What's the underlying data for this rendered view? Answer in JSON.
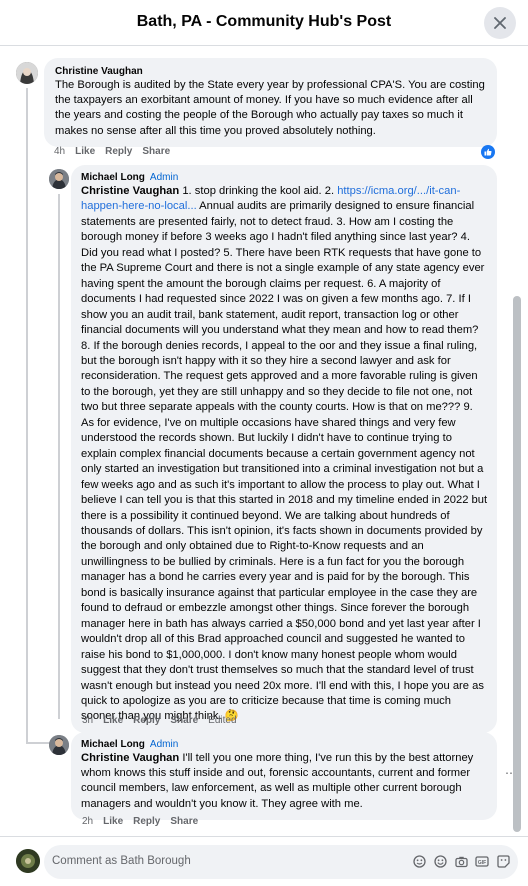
{
  "header": {
    "title": "Bath, PA - Community Hub's Post"
  },
  "comments": [
    {
      "author": "Christine Vaughan",
      "badge": "",
      "text": "The Borough is audited by the State every year by professional CPA'S. You are costing the taxpayers an exorbitant amount of money. If you have so much evidence after all the years and costing the people of the Borough who actually pay taxes so much it makes no sense after all this time you proved absolutely nothing.",
      "time": "4h",
      "like": "Like",
      "reply": "Reply",
      "share": "Share",
      "reaction": "like"
    },
    {
      "author": "Michael Long",
      "badge": "Admin",
      "mention": "Christine Vaughan",
      "text_before_link": " 1. stop drinking the kool aid. 2. ",
      "link": "https://icma.org/.../it-can-happen-here-no-local...",
      "text_after_link": " Annual audits are primarily designed to ensure financial statements are presented fairly, not to detect fraud. 3. How am I costing the borough money if before 3 weeks ago I hadn't filed anything since last year? 4. Did you read what I posted? 5. There have been RTK requests that have gone to the PA Supreme Court and there is not a single example of any state agency ever having spent the amount the borough claims per request. 6. A majority of documents I had requested since 2022 I was on given a few months ago. 7. If I show you an audit trail, bank statement, audit report, transaction log or other financial documents will you understand what they mean and how to read them? 8. If the borough denies records, I appeal to the oor and they issue a final ruling, but the borough isn't happy with it so they hire a second lawyer and ask for reconsideration. The request gets approved and a more favorable ruling is given to the borough, yet they are still unhappy and so they decide to file not one, not two but three separate appeals with the county courts. How is that on me??? 9. As for evidence, I've on multiple occasions have shared things and very few understood the records shown. But luckily I didn't have to continue trying to explain complex financial documents because a certain government agency not only started an investigation but transitioned into a criminal investigation not but a few weeks ago and as such it's important to allow the process to play out. What I believe I can tell you is that this started in 2018 and my timeline ended in 2022 but there is a possibility it continued beyond. We are talking about hundreds of thousands of dollars. This isn't opinion, it's facts shown in documents provided by the borough and only obtained due to Right-to-Know requests and an unwillingness to be bullied by criminals. Here is a fun fact for you the borough manager has a bond he carries every year and is paid for by the borough. This bond is basically insurance against that particular employee in the case they are found to defraud or embezzle amongst other things. Since forever the borough manager here in bath has always carried a $50,000 bond and yet last year after I wouldn't drop all of this Brad approached council and suggested he wanted to raise his bond to $1,000,000. I don't know many honest people whom would suggest that they don't trust themselves so much that the standard level of trust wasn't enough but instead you need 20x more. I'll end with this, I hope you are as quick to apologize as you are to criticize because that time is coming much sooner than you might think. 🤔",
      "time": "3h",
      "like": "Like",
      "reply": "Reply",
      "share": "Share",
      "edited": "Edited"
    },
    {
      "author": "Michael Long",
      "badge": "Admin",
      "mention": "Christine Vaughan",
      "text": " I'll tell you one more thing, I've run this by the best attorney whom knows this stuff inside and out, forensic accountants, current and former council members, law enforcement, as well as multiple other current borough managers and wouldn't you know it. They agree with me.",
      "time": "2h",
      "like": "Like",
      "reply": "Reply",
      "share": "Share"
    }
  ],
  "composer": {
    "placeholder": "Comment as Bath Borough"
  },
  "icons": {
    "close": "close-icon",
    "like_reaction": "thumbs-up-icon",
    "composer": [
      "sticker-icon",
      "emoji-icon",
      "camera-icon",
      "gif-icon",
      "sticker-smile-icon"
    ]
  },
  "colors": {
    "accent": "#1877f2",
    "link": "#216fdb",
    "admin": "#0064d1",
    "bubble": "#f0f2f5"
  }
}
